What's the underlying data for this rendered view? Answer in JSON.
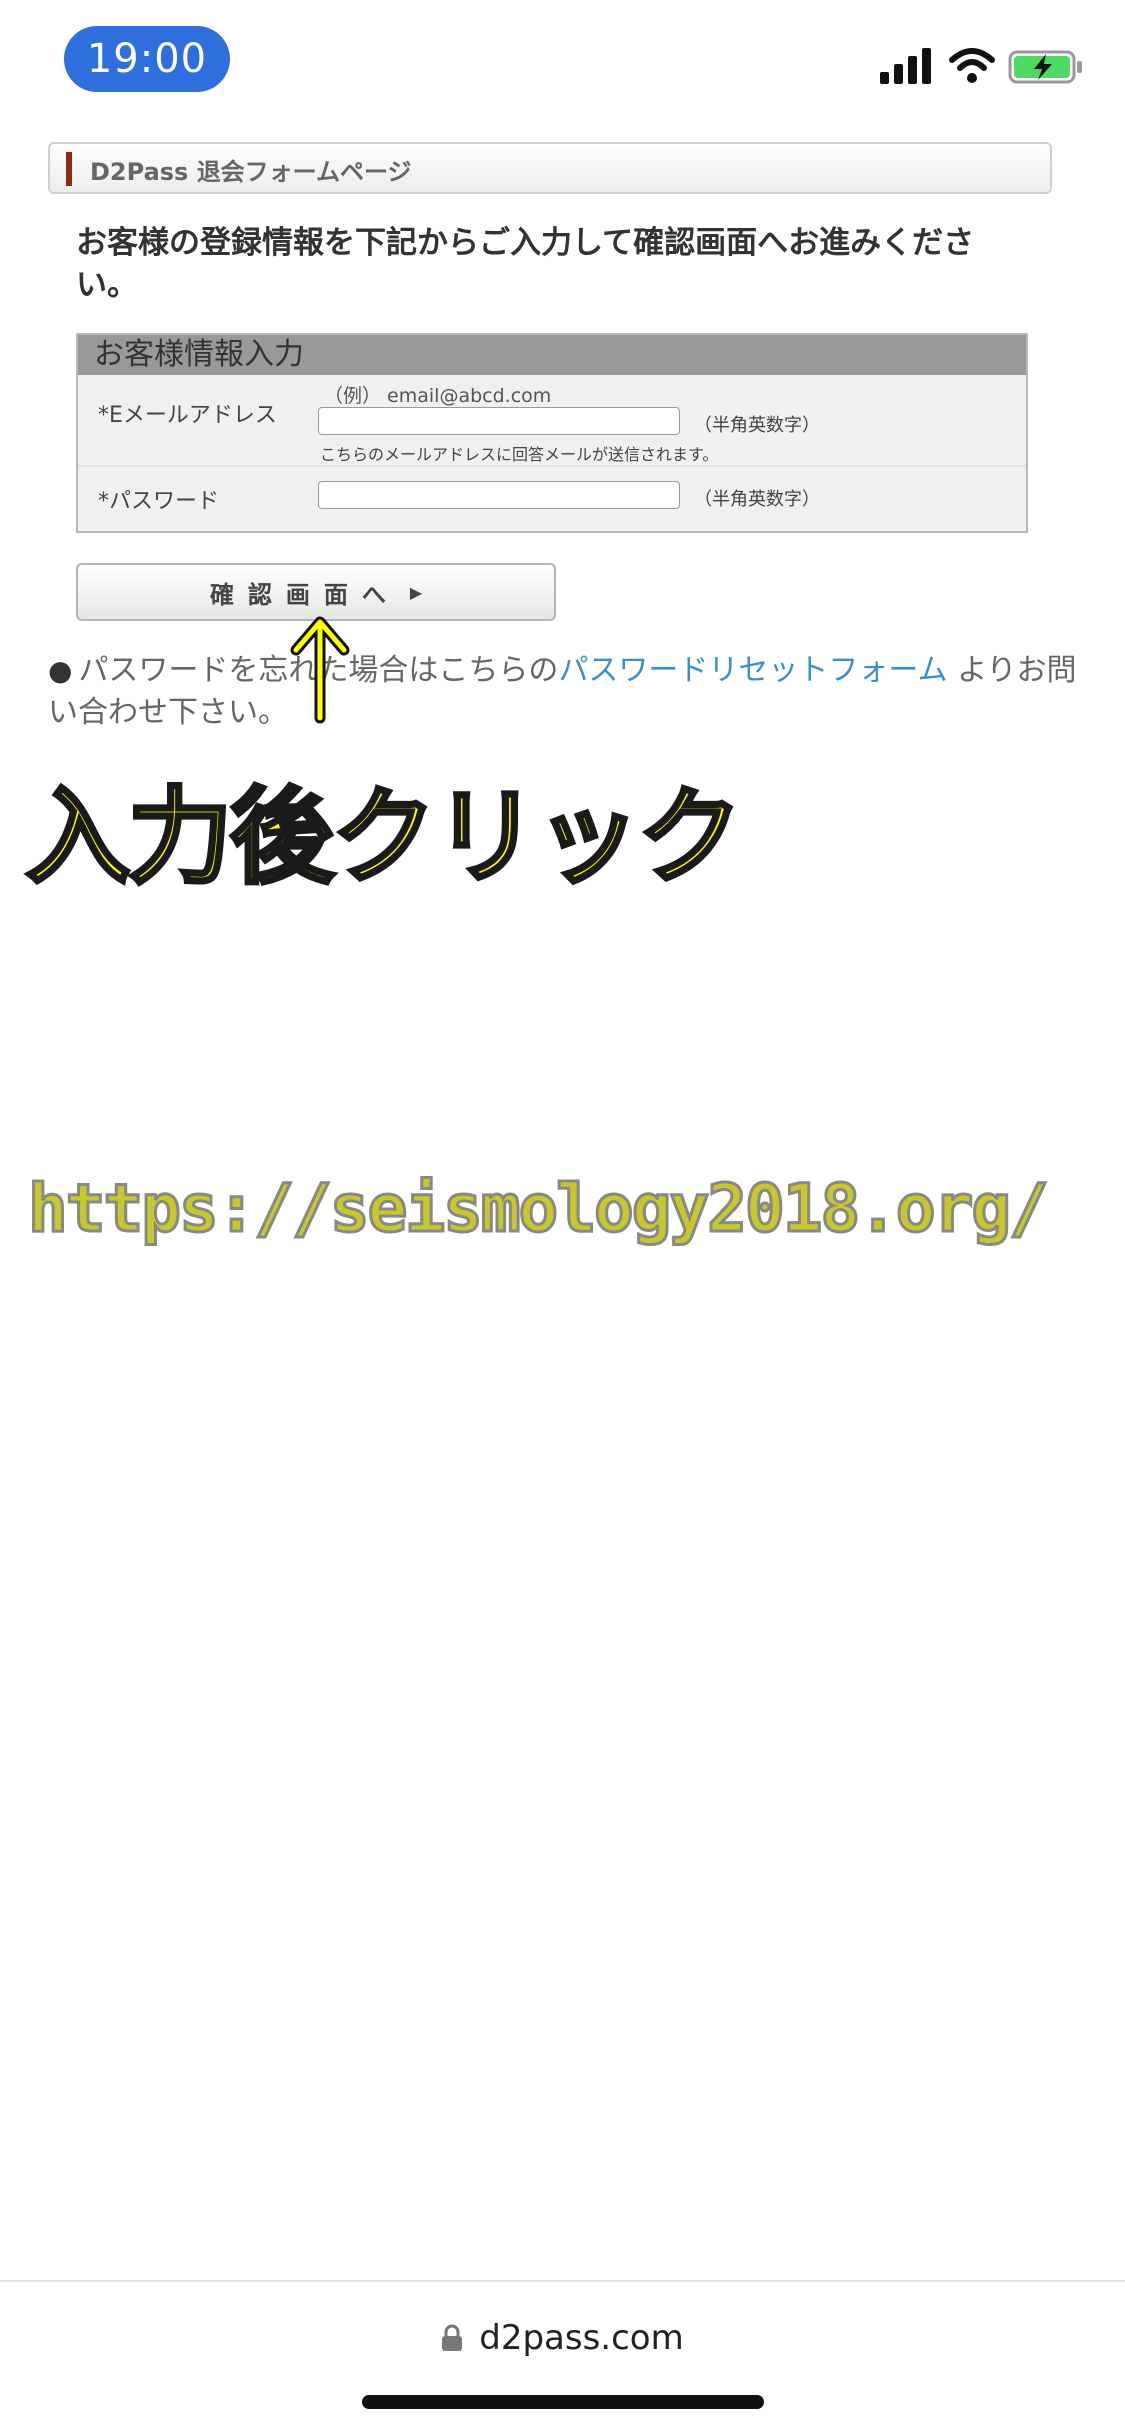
{
  "status_bar": {
    "time": "19:00"
  },
  "header": {
    "title": "D2Pass 退会フォームページ"
  },
  "instruction": "お客様の登録情報を下記からご入力して確認画面へお進みください。",
  "form": {
    "title": "お客様情報入力",
    "email": {
      "label": "*Eメールアドレス",
      "example": "（例） email@abcd.com",
      "value": "",
      "hint": "（半角英数字）",
      "note": "こちらのメールアドレスに回答メールが送信されます。"
    },
    "password": {
      "label": "*パスワード",
      "value": "",
      "hint": "（半角英数字）"
    }
  },
  "confirm_button": {
    "label": "確認画面へ"
  },
  "forgot": {
    "prefix": "パスワードを忘れた場合はこちらの",
    "link": "パスワードリセットフォーム",
    "suffix": "よりお問い合わせ下さい。"
  },
  "annotations": {
    "click_text": "入力後クリック",
    "url_text": "https://seismology2018.org/"
  },
  "browser": {
    "domain": "d2pass.com"
  },
  "colors": {
    "time_pill": "#2f6fdd",
    "link": "#3b8fd0",
    "header_accent": "#8a2b12",
    "overlay_yellow": "#ffff00",
    "battery_green": "#4cd964"
  },
  "icons": {
    "signal": "signal-icon",
    "wifi": "wifi-icon",
    "battery": "battery-charging-icon",
    "lock": "lock-icon",
    "arrow": "triangle-right-icon"
  }
}
